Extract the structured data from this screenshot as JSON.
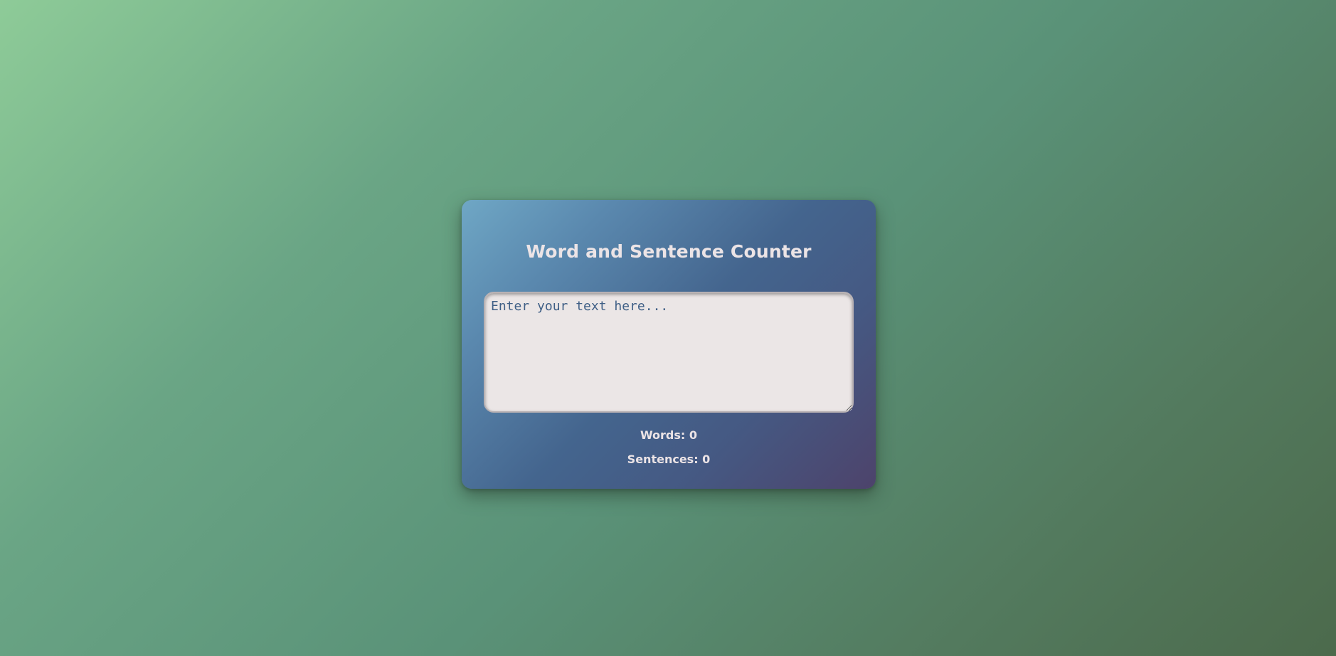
{
  "app": {
    "title": "Word and Sentence Counter"
  },
  "editor": {
    "placeholder": "Enter your text here...",
    "value": ""
  },
  "stats": {
    "words_label": "Words:",
    "words_value": "0",
    "sentences_label": "Sentences:",
    "sentences_value": "0"
  },
  "colors": {
    "background_start": "#8ecb98",
    "background_end": "#4c6a4c",
    "card_start": "#6fa7c5",
    "card_end": "#4d436b",
    "text_light": "#ece4e6",
    "textarea_bg": "#ebe6e6",
    "placeholder": "#3f5f86"
  }
}
